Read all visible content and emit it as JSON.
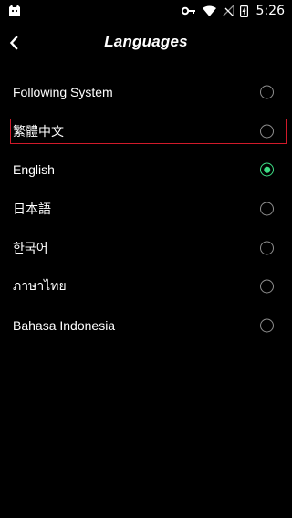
{
  "status_bar": {
    "time": "5:26",
    "icons": [
      "app-notification-icon",
      "vpn-key-icon",
      "wifi-icon",
      "no-signal-icon",
      "battery-charging-icon"
    ]
  },
  "header": {
    "title": "Languages",
    "back_icon": "chevron-left-icon"
  },
  "languages": [
    {
      "label": "Following System",
      "selected": false
    },
    {
      "label": "繁體中文",
      "selected": false
    },
    {
      "label": "English",
      "selected": true
    },
    {
      "label": "日本語",
      "selected": false
    },
    {
      "label": "한국어",
      "selected": false
    },
    {
      "label": "ภาษาไทย",
      "selected": false
    },
    {
      "label": "Bahasa Indonesia",
      "selected": false
    }
  ],
  "colors": {
    "background": "#000000",
    "text": "#ffffff",
    "radio_border": "#8e8e8e",
    "radio_selected": "#3ddc84",
    "highlight": "#d11a2a"
  }
}
